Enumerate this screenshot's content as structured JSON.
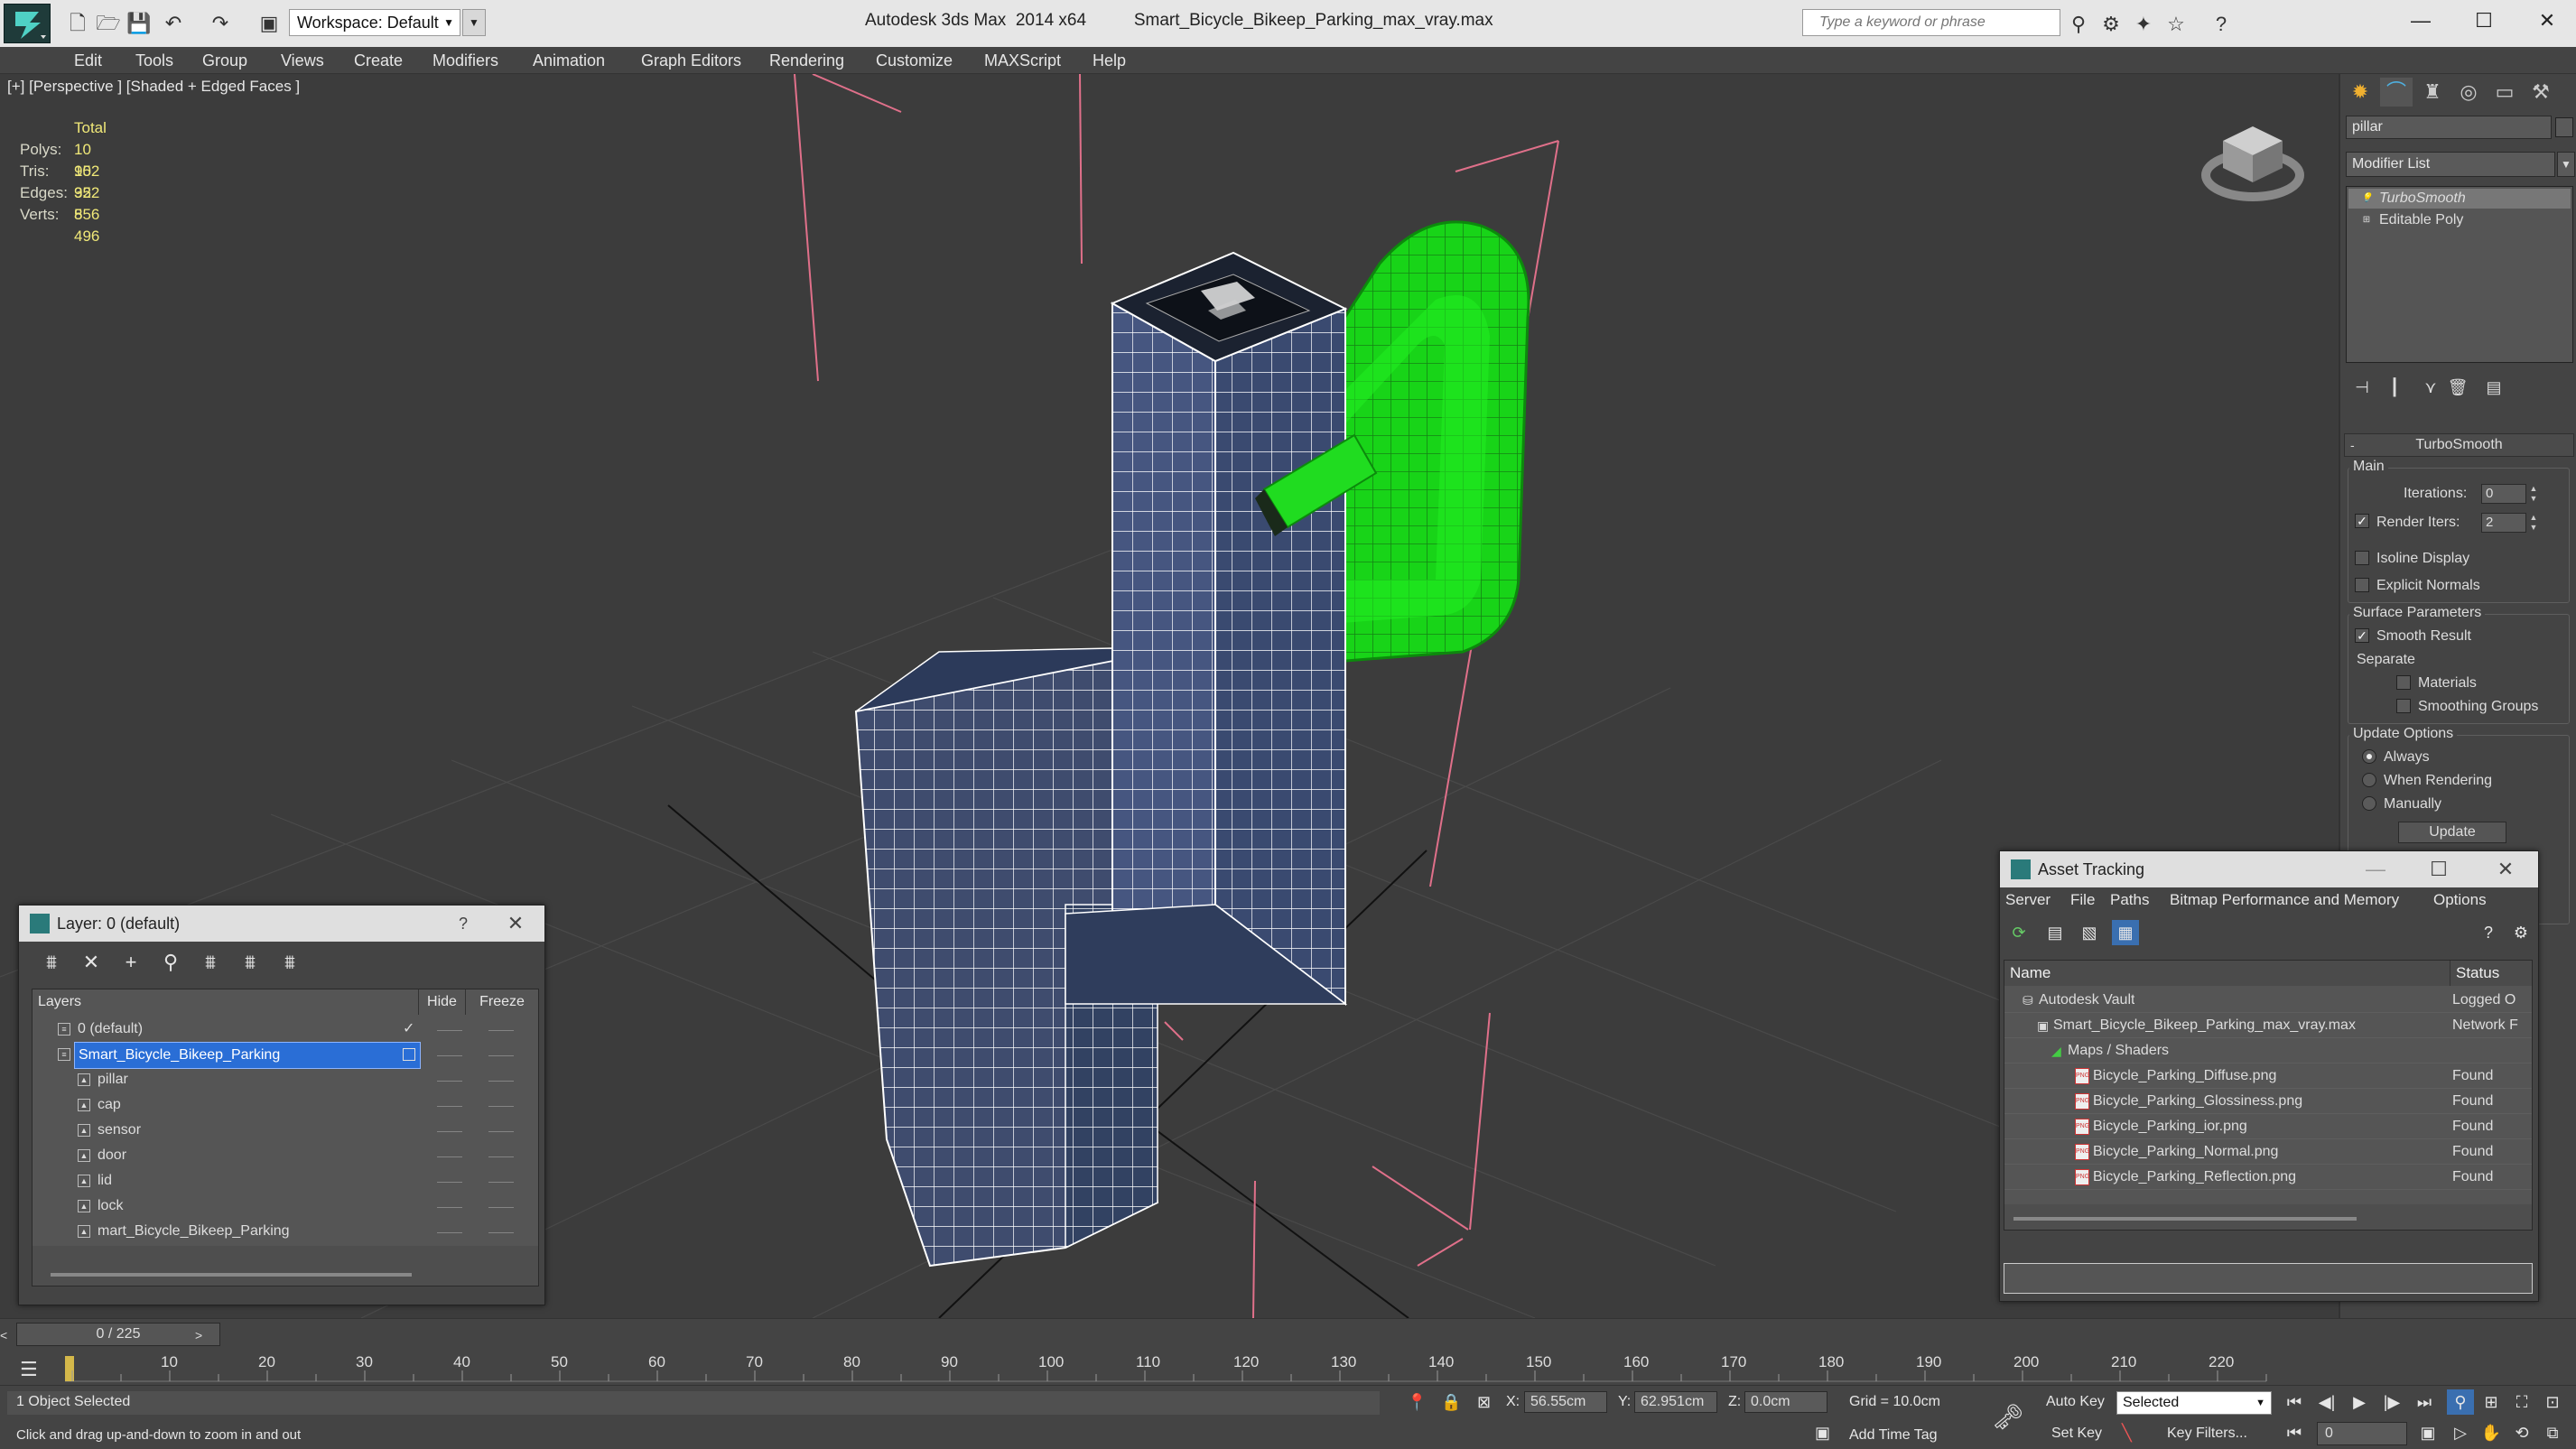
{
  "titlebar": {
    "workspace": "Workspace: Default",
    "app_title": "Autodesk 3ds Max  2014 x64",
    "file_title": "Smart_Bicycle_Bikeep_Parking_max_vray.max",
    "search_placeholder": "Type a keyword or phrase"
  },
  "menu": [
    "Edit",
    "Tools",
    "Group",
    "Views",
    "Create",
    "Modifiers",
    "Animation",
    "Graph Editors",
    "Rendering",
    "Customize",
    "MAXScript",
    "Help"
  ],
  "viewport": {
    "label": "[+] [Perspective ] [Shaded + Edged Faces ]",
    "stats": {
      "header": "Total",
      "rows": [
        {
          "k": "Polys:",
          "v": "10 952"
        },
        {
          "k": "Tris:",
          "v": "10 952"
        },
        {
          "k": "Edges:",
          "v": "32 856"
        },
        {
          "k": "Verts:",
          "v": "5 496"
        }
      ]
    }
  },
  "command_panel": {
    "object_name": "pillar",
    "modifier_list": "Modifier List",
    "stack": [
      "TurboSmooth",
      "Editable Poly"
    ],
    "turbosmooth": {
      "title": "TurboSmooth",
      "main": "Main",
      "iterations_label": "Iterations:",
      "iterations": "0",
      "render_iters_label": "Render Iters:",
      "render_iters": "2",
      "isoline": "Isoline Display",
      "explicit": "Explicit Normals",
      "surface": "Surface Parameters",
      "smooth_result": "Smooth Result",
      "separate": "Separate",
      "materials": "Materials",
      "smoothing_groups": "Smoothing Groups",
      "update_options": "Update Options",
      "always": "Always",
      "when_rendering": "When Rendering",
      "manually": "Manually",
      "update": "Update"
    }
  },
  "layer_dialog": {
    "title": "Layer: 0 (default)",
    "help": "?",
    "col_layers": "Layers",
    "col_hide": "Hide",
    "col_freeze": "Freeze",
    "rows": [
      {
        "name": "0 (default)"
      },
      {
        "name": "Smart_Bicycle_Bikeep_Parking"
      },
      {
        "name": "pillar"
      },
      {
        "name": "cap"
      },
      {
        "name": "sensor"
      },
      {
        "name": "door"
      },
      {
        "name": "lid"
      },
      {
        "name": "lock"
      },
      {
        "name": "mart_Bicycle_Bikeep_Parking"
      }
    ]
  },
  "asset_tracking": {
    "title": "Asset Tracking",
    "menu": [
      "Server",
      "File",
      "Paths",
      "Bitmap Performance and Memory",
      "Options"
    ],
    "col_name": "Name",
    "col_status": "Status",
    "rows": [
      {
        "name": "Autodesk Vault",
        "status": "Logged O"
      },
      {
        "name": "Smart_Bicycle_Bikeep_Parking_max_vray.max",
        "status": "Network F"
      },
      {
        "name": "Maps / Shaders",
        "status": ""
      },
      {
        "name": "Bicycle_Parking_Diffuse.png",
        "status": "Found"
      },
      {
        "name": "Bicycle_Parking_Glossiness.png",
        "status": "Found"
      },
      {
        "name": "Bicycle_Parking_ior.png",
        "status": "Found"
      },
      {
        "name": "Bicycle_Parking_Normal.png",
        "status": "Found"
      },
      {
        "name": "Bicycle_Parking_Reflection.png",
        "status": "Found"
      }
    ]
  },
  "timeline": {
    "frame": "0 / 225",
    "ticks": [
      "10",
      "20",
      "30",
      "40",
      "50",
      "60",
      "70",
      "80",
      "90",
      "100",
      "110",
      "120",
      "130",
      "140",
      "150",
      "160",
      "170",
      "180",
      "190",
      "200",
      "210",
      "220"
    ]
  },
  "status": {
    "selection": "1 Object Selected",
    "prompt": "Click and drag up-and-down to zoom in and out",
    "x_label": "X:",
    "x": "56.55cm",
    "y_label": "Y:",
    "y": "62.951cm",
    "z_label": "Z:",
    "z": "0.0cm",
    "grid": "Grid = 10.0cm",
    "add_time_tag": "Add Time Tag",
    "auto_key": "Auto Key",
    "selected": "Selected",
    "set_key": "Set Key",
    "key_filters": "Key Filters...",
    "frame_value": "0"
  },
  "colors": {
    "selection_highlight": "#2a6ed6",
    "stats_value": "#f0e878",
    "lock_green": "#22dd22",
    "pillar_blue": "#36466a"
  }
}
